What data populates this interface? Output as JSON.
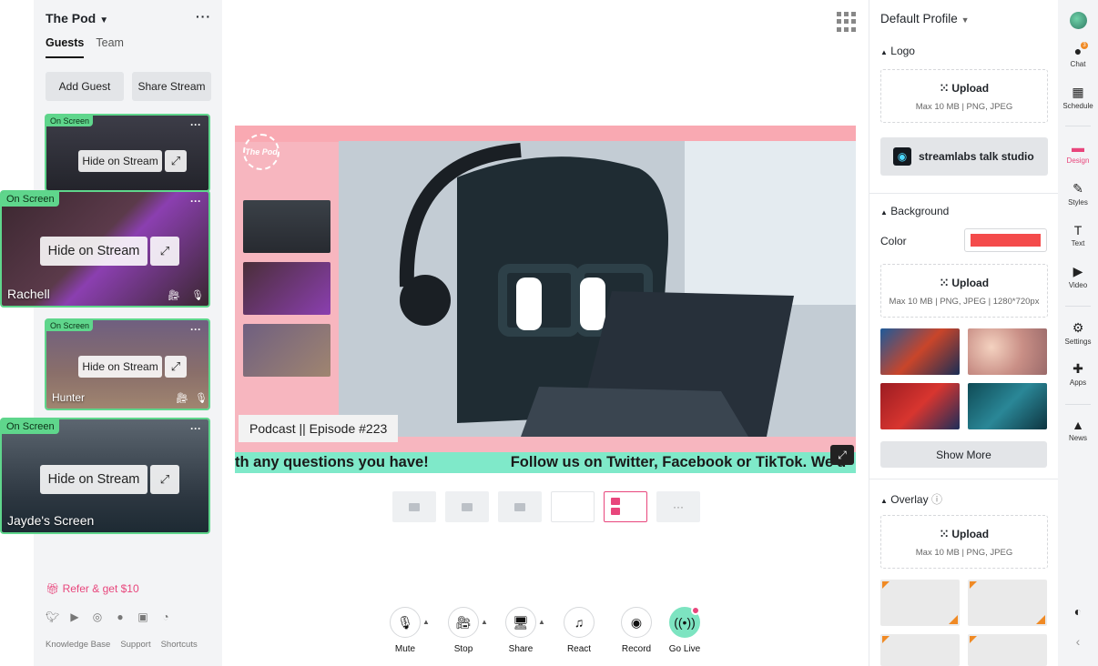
{
  "left_panel": {
    "title": "The Pod",
    "tabs": [
      {
        "label": "Guests"
      },
      {
        "label": "Team"
      }
    ],
    "add_guest": "Add Guest",
    "share_stream": "Share Stream",
    "cards": [
      {
        "badge": "On Screen",
        "hide_label": "Hide on Stream",
        "name": ""
      },
      {
        "badge": "On Screen",
        "hide_label": "Hide on Stream",
        "name": "Rachell"
      },
      {
        "badge": "On Screen",
        "hide_label": "Hide on Stream",
        "name": "Hunter"
      },
      {
        "badge": "On Screen",
        "hide_label": "Hide on Stream",
        "name": "Jayde's Screen"
      }
    ],
    "refer": "Refer & get $10",
    "footer_links": [
      "Knowledge Base",
      "Support",
      "Shortcuts"
    ]
  },
  "stage": {
    "logo_text": "The Pod",
    "episode": "Podcast || Episode #223",
    "ticker": [
      "th any questions you have!",
      "Follow us on Twitter, Facebook or TikTok. We'd"
    ]
  },
  "controls": [
    {
      "label": "Mute",
      "icon": "microphone-icon"
    },
    {
      "label": "Stop",
      "icon": "camera-icon"
    },
    {
      "label": "Share",
      "icon": "monitor-icon"
    },
    {
      "label": "React",
      "icon": "music-note-icon"
    },
    {
      "label": "Record",
      "icon": "record-icon"
    },
    {
      "label": "Go Live",
      "icon": "broadcast-icon"
    }
  ],
  "right_panel": {
    "profile": "Default Profile",
    "logo_section": "Logo",
    "upload": "Upload",
    "logo_hint": "Max 10 MB | PNG, JPEG",
    "talk_studio": "streamlabs talk studio",
    "background_section": "Background",
    "color_label": "Color",
    "bg_color": "#f44b4b",
    "bg_hint": "Max 10 MB | PNG, JPEG | 1280*720px",
    "show_more": "Show More",
    "overlay_section": "Overlay",
    "overlay_hint": "Max 10 MB | PNG, JPEG"
  },
  "nav": {
    "chat_badge": "3",
    "items": [
      {
        "label": "Chat",
        "icon": "chat-icon"
      },
      {
        "label": "Schedule",
        "icon": "calendar-icon"
      },
      {
        "label": "Design",
        "icon": "design-icon"
      },
      {
        "label": "Styles",
        "icon": "brush-icon"
      },
      {
        "label": "Text",
        "icon": "text-icon"
      },
      {
        "label": "Video",
        "icon": "video-icon"
      },
      {
        "label": "Settings",
        "icon": "gear-icon"
      },
      {
        "label": "Apps",
        "icon": "puzzle-icon"
      },
      {
        "label": "News",
        "icon": "bell-icon"
      }
    ]
  },
  "colors": {
    "accent": "#e8467c",
    "onscreen": "#5fd68c",
    "ticker": "#7fe9c9",
    "golive": "#7de4c1"
  }
}
